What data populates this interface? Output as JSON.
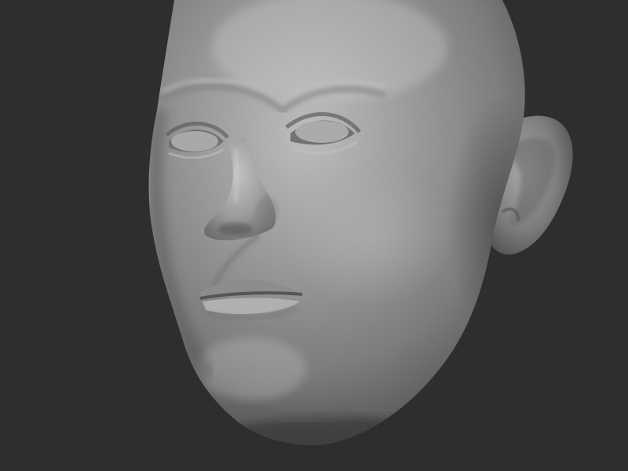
{
  "scene": {
    "background_color": "#2e2e2e",
    "material_color": "#8c8c8c",
    "subject": "head-sculpt",
    "view": "three-quarter-left"
  }
}
